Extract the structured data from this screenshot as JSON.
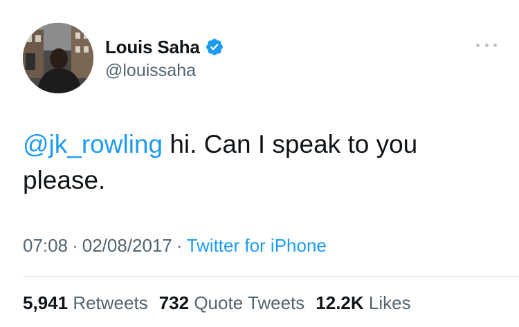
{
  "user": {
    "display_name": "Louis Saha",
    "handle": "@louissaha",
    "verified": true,
    "verified_color": "#1d9bf0"
  },
  "tweet": {
    "mention": "@jk_rowling",
    "text": " hi. Can I speak to you please.",
    "time": "07:08",
    "date": "02/08/2017",
    "separator": "·",
    "source": "Twitter for iPhone"
  },
  "stats": {
    "retweets_count": "5,941",
    "retweets_label": "Retweets",
    "quotes_count": "732",
    "quotes_label": "Quote Tweets",
    "likes_count": "12.2K",
    "likes_label": "Likes"
  },
  "icons": {
    "more": "more-options-icon",
    "verified": "verified-badge-icon"
  },
  "colors": {
    "link": "#1d9bf0",
    "secondary_text": "#536471",
    "primary_text": "#0f1419"
  }
}
